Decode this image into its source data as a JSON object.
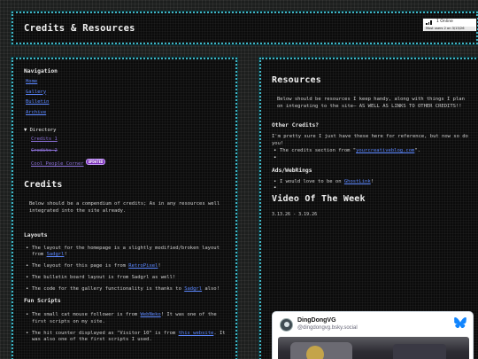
{
  "header": {
    "title": "Credits & Resources",
    "online_label": "1 Online",
    "online_subtext": "Most users 2 on 3/13/26"
  },
  "nav": {
    "heading": "Navigation",
    "items": [
      {
        "label": "Home"
      },
      {
        "label": "Gallery"
      },
      {
        "label": "Bulletin"
      },
      {
        "label": "Archive"
      }
    ],
    "directory_label": "Directory",
    "directory_items": [
      {
        "label": "Credits 1"
      },
      {
        "label": "Credits 2"
      },
      {
        "label": "Cool People Corner",
        "badge": "UPDATED"
      }
    ]
  },
  "credits": {
    "title": "Credits",
    "intro": "Below should be a compendium of credits; As in any resources well integrated into the site already.",
    "layouts_heading": "Layouts",
    "layouts": [
      {
        "text": "The layout for the homepage is a slightly modified/broken layout from ",
        "link": "Sadgrl",
        "after": "!"
      },
      {
        "text": "The layout for this page is from ",
        "link": "RetroPixel",
        "after": "!"
      },
      {
        "text": "The bulletin board layout is from Sadgrl as well!",
        "link": "",
        "after": ""
      },
      {
        "text": "The code for the gallery functionality is thanks to ",
        "link": "Sadgrl",
        "after": " also!"
      }
    ],
    "scripts_heading": "Fun Scripts",
    "scripts": [
      {
        "text": "The small cat mouse follower is from ",
        "link": "WebNeko",
        "after": "! It was one of the first scripts on my site."
      },
      {
        "text": "The hit counter displayed as \"Visitor 10\" is from ",
        "link": "this website",
        "after": ". It was also one of the first scripts I used."
      }
    ]
  },
  "resources": {
    "title": "Resources",
    "intro": "Below should be resources I keep handy, along with things I plan on integrating to the site— AS WELL AS LINKS TO OTHER CREDITS!!",
    "other_heading": "Other Credits?",
    "other_text": "I'm pretty sure I just have these here for reference, but now so do you!",
    "other_items": [
      {
        "text": "",
        "link": "",
        "after": ""
      },
      {
        "text": "The credits section from \"",
        "link": "yourcreativeblog.com",
        "after": "\"."
      },
      {
        "text": "",
        "link": "",
        "after": ""
      },
      {
        "text": "",
        "link": "",
        "after": ""
      },
      {
        "text": "",
        "link": "",
        "after": ""
      }
    ],
    "ads_heading": "Ads/WebRings",
    "ads_items": [
      {
        "text": "I would love to be on ",
        "link": "GhostLink",
        "after": "!"
      },
      {
        "text": "",
        "link": "",
        "after": ""
      },
      {
        "text": "",
        "link": "",
        "after": ""
      },
      {
        "text": "",
        "link": "",
        "after": ""
      },
      {
        "text": "",
        "link": "",
        "after": ""
      }
    ],
    "video_title": "Video Of The Week",
    "video_date": "3.13.26 - 3.19.26"
  },
  "bsky": {
    "name": "DingDongVG",
    "handle": "@dingdongvg.bsky.social"
  },
  "colors": {
    "border": "#3fb6c6",
    "link": "#5b87ff",
    "visited": "#8a6fd6",
    "badge": "#7a2fb8",
    "bluesky": "#1185fe"
  }
}
